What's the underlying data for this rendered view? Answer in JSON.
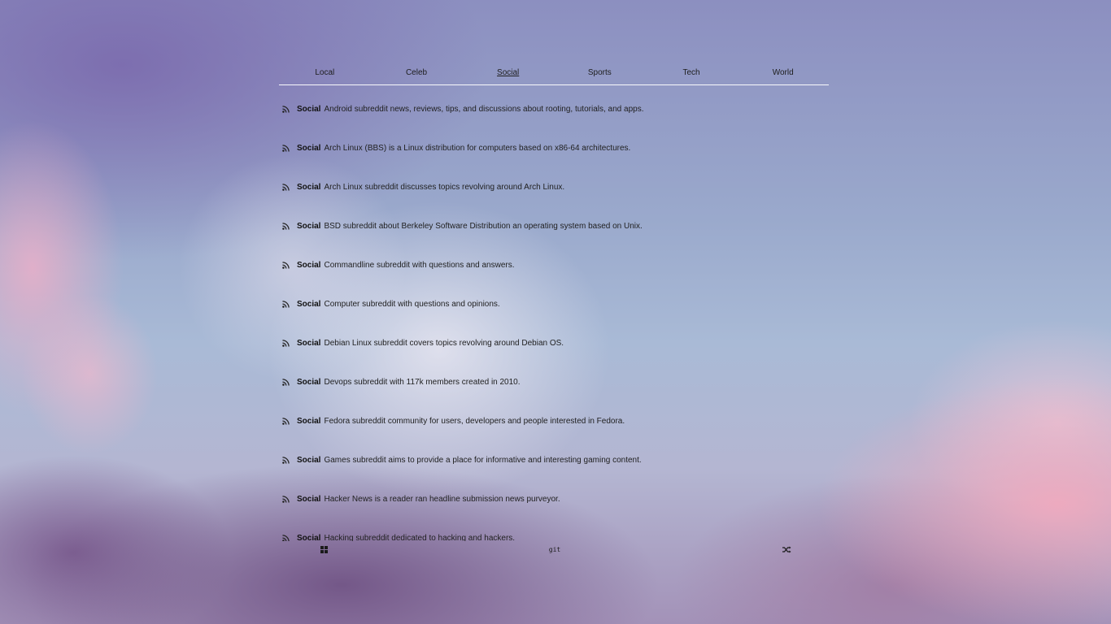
{
  "tabs": [
    {
      "label": "Local",
      "active": false
    },
    {
      "label": "Celeb",
      "active": false
    },
    {
      "label": "Social",
      "active": true
    },
    {
      "label": "Sports",
      "active": false
    },
    {
      "label": "Tech",
      "active": false
    },
    {
      "label": "World",
      "active": false
    }
  ],
  "feed": {
    "items": [
      {
        "source": "Social",
        "text": "Android subreddit news, reviews, tips, and discussions about rooting, tutorials, and apps.",
        "icon": "rss-icon"
      },
      {
        "source": "Social",
        "text": "Arch Linux (BBS) is a Linux distribution for computers based on x86-64 architectures.",
        "icon": "rss-icon"
      },
      {
        "source": "Social",
        "text": "Arch Linux subreddit discusses topics revolving around Arch Linux.",
        "icon": "rss-icon"
      },
      {
        "source": "Social",
        "text": "BSD subreddit about Berkeley Software Distribution an operating system based on Unix.",
        "icon": "rss-icon"
      },
      {
        "source": "Social",
        "text": "Commandline subreddit with questions and answers.",
        "icon": "rss-icon"
      },
      {
        "source": "Social",
        "text": "Computer subreddit with questions and opinions.",
        "icon": "rss-icon"
      },
      {
        "source": "Social",
        "text": "Debian Linux subreddit covers topics revolving around Debian OS.",
        "icon": "rss-icon"
      },
      {
        "source": "Social",
        "text": "Devops subreddit with 117k members created in 2010.",
        "icon": "rss-icon"
      },
      {
        "source": "Social",
        "text": "Fedora subreddit community for users, developers and people interested in Fedora.",
        "icon": "rss-icon"
      },
      {
        "source": "Social",
        "text": "Games subreddit aims to provide a place for informative and interesting gaming content.",
        "icon": "rss-icon"
      },
      {
        "source": "Social",
        "text": "Hacker News is a reader ran headline submission news purveyor.",
        "icon": "rss-icon"
      },
      {
        "source": "Social",
        "text": "Hacking subreddit dedicated to hacking and hackers.",
        "icon": "rss-icon"
      }
    ]
  },
  "footer": {
    "grid_icon": "grid-icon",
    "git_label": "git",
    "shuffle_icon": "shuffle-icon"
  }
}
